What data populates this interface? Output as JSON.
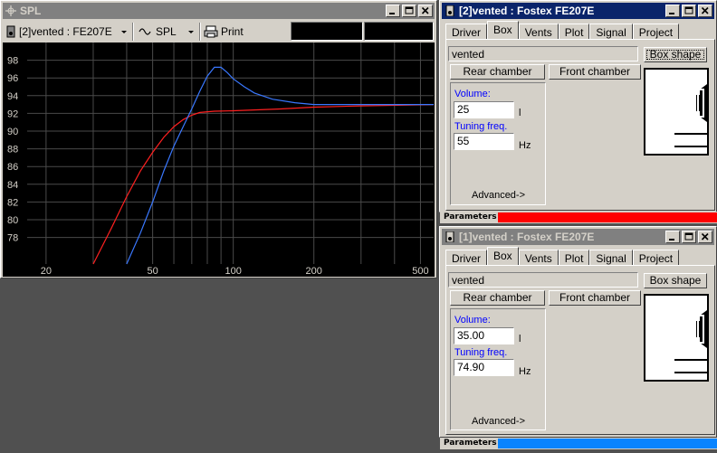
{
  "spl_window": {
    "title": "SPL",
    "curve_selector": "[2]vented : FE207E",
    "mode_selector": "SPL",
    "print_label": "Print"
  },
  "window2": {
    "title": "[2]vented : Fostex FE207E",
    "tabs": [
      "Driver",
      "Box",
      "Vents",
      "Plot",
      "Signal",
      "Project"
    ],
    "box_type": "vented",
    "box_shape_label": "Box shape",
    "rear_chamber_label": "Rear chamber",
    "front_chamber_label": "Front chamber",
    "volume_label": "Volume:",
    "volume_value": "25",
    "volume_unit": "l",
    "tuning_label": "Tuning freq.",
    "tuning_value": "55",
    "tuning_unit": "Hz",
    "advanced_label": "Advanced->",
    "status_label": "Parameters",
    "status_color": "#ff0000"
  },
  "window1": {
    "title": "[1]vented : Fostex FE207E",
    "tabs": [
      "Driver",
      "Box",
      "Vents",
      "Plot",
      "Signal",
      "Project"
    ],
    "box_type": "vented",
    "box_shape_label": "Box shape",
    "rear_chamber_label": "Rear chamber",
    "front_chamber_label": "Front chamber",
    "volume_label": "Volume:",
    "volume_value": "35.00",
    "volume_unit": "l",
    "tuning_label": "Tuning freq.",
    "tuning_value": "74.90",
    "tuning_unit": "Hz",
    "advanced_label": "Advanced->",
    "status_label": "Parameters",
    "status_color": "#0a84ff"
  },
  "chart_data": {
    "type": "line",
    "xscale": "log",
    "xlim": [
      17,
      560
    ],
    "ylim": [
      75,
      100
    ],
    "grid": true,
    "ytick_labels": [
      "98",
      "96",
      "94",
      "92",
      "90",
      "88",
      "86",
      "84",
      "82",
      "80",
      "78"
    ],
    "xtick_labels": [
      "20",
      "50",
      "100",
      "200",
      "500"
    ],
    "series": [
      {
        "color": "#ff2020",
        "points": [
          [
            30,
            75
          ],
          [
            35,
            79
          ],
          [
            40,
            82.6
          ],
          [
            45,
            85.5
          ],
          [
            50,
            87.6
          ],
          [
            55,
            89.3
          ],
          [
            60,
            90.5
          ],
          [
            65,
            91.3
          ],
          [
            70,
            91.8
          ],
          [
            75,
            92.1
          ],
          [
            85,
            92.25
          ],
          [
            100,
            92.3
          ],
          [
            150,
            92.5
          ],
          [
            200,
            92.7
          ],
          [
            300,
            92.85
          ],
          [
            560,
            93
          ]
        ]
      },
      {
        "color": "#3a78ff",
        "points": [
          [
            40,
            75
          ],
          [
            45,
            78.5
          ],
          [
            50,
            82
          ],
          [
            55,
            85.5
          ],
          [
            60,
            88.3
          ],
          [
            65,
            90.5
          ],
          [
            70,
            92.5
          ],
          [
            75,
            94.5
          ],
          [
            80,
            96.2
          ],
          [
            85,
            97.2
          ],
          [
            90,
            97.2
          ],
          [
            95,
            96.6
          ],
          [
            100,
            95.9
          ],
          [
            110,
            95
          ],
          [
            120,
            94.3
          ],
          [
            140,
            93.6
          ],
          [
            170,
            93.2
          ],
          [
            200,
            93
          ],
          [
            300,
            93
          ],
          [
            560,
            93
          ]
        ]
      }
    ]
  }
}
